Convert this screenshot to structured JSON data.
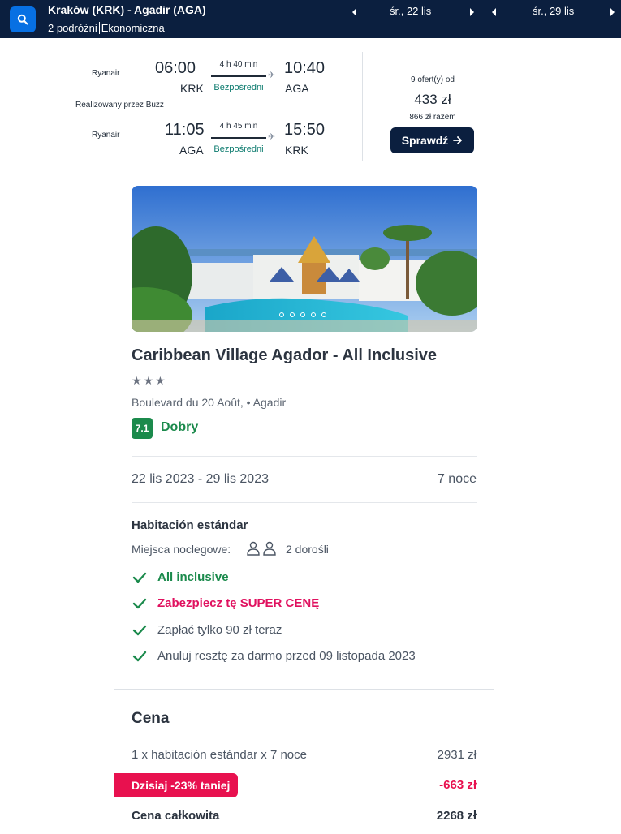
{
  "header": {
    "route": "Kraków (KRK) - Agadir (AGA)",
    "travellers": "2 podróżni",
    "cabin": "Ekonomiczna",
    "depart_date": "śr., 22 lis",
    "return_date": "śr., 29 lis"
  },
  "flight": {
    "outbound": {
      "airline": "Ryanair",
      "dep_time": "06:00",
      "dep_code": "KRK",
      "arr_time": "10:40",
      "arr_code": "AGA",
      "duration": "4 h 40 min",
      "stops": "Bezpośredni"
    },
    "operated_by": "Realizowany przez Buzz",
    "inbound": {
      "airline": "Ryanair",
      "dep_time": "11:05",
      "dep_code": "AGA",
      "arr_time": "15:50",
      "arr_code": "KRK",
      "duration": "4 h 45 min",
      "stops": "Bezpośredni"
    },
    "offers": "9 ofert(y) od",
    "price": "433 zł",
    "total": "866 zł razem",
    "cta": "Sprawdź"
  },
  "hotel": {
    "name": "Caribbean Village Agador - All Inclusive",
    "stars": 3,
    "address": "Boulevard du 20 Août, • Agadir",
    "score": "7.1",
    "score_label": "Dobry",
    "dates": "22 lis 2023 - 29 lis 2023",
    "nights": "7 noce",
    "room_type": "Habitación estándar",
    "occupancy_label": "Miejsca noclegowe:",
    "occupancy_value": "2 dorośli",
    "features": [
      "All inclusive",
      "Zabezpiecz tę SUPER CENĘ",
      "Zapłać tylko 90 zł teraz",
      "Anuluj resztę za darmo przed 09 listopada 2023"
    ],
    "price_section": {
      "title": "Cena",
      "line_label": "1 x habitación estándar x 7 noce",
      "line_value": "2931 zł",
      "promo": "Dzisiaj -23% taniej",
      "discount": "-663 zł",
      "total_label": "Cena całkowita",
      "total_value": "2268 zł"
    }
  },
  "colors": {
    "header_bg": "#0b1f3f",
    "accent_blue": "#0770e3",
    "success_green": "#1b8a4c",
    "promo_pink": "#e8114f"
  }
}
